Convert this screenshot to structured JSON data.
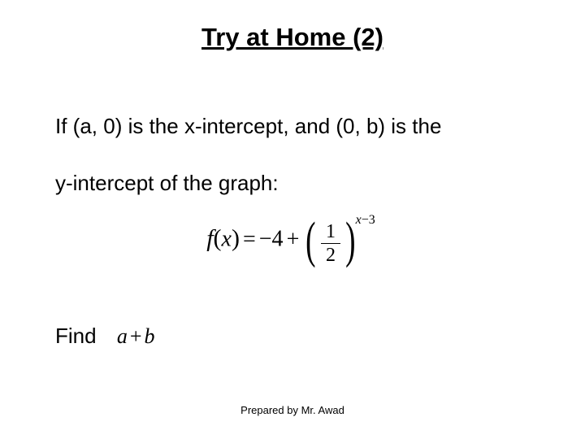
{
  "title": "Try at Home (2)",
  "line1": "If (a, 0) is the x-intercept, and (0, b) is the",
  "line2": "y-intercept of the graph:",
  "formula": {
    "f": "f",
    "lparen": "(",
    "x": "x",
    "rparen": ")",
    "eq": "=",
    "neg4": "−4",
    "plus": "+",
    "frac_num": "1",
    "frac_den": "2",
    "exp_x": "x",
    "exp_rest": "−3"
  },
  "find_label": "Find",
  "find_expr": {
    "a": "a",
    "plus": "+",
    "b": "b"
  },
  "footer": "Prepared by Mr. Awad"
}
